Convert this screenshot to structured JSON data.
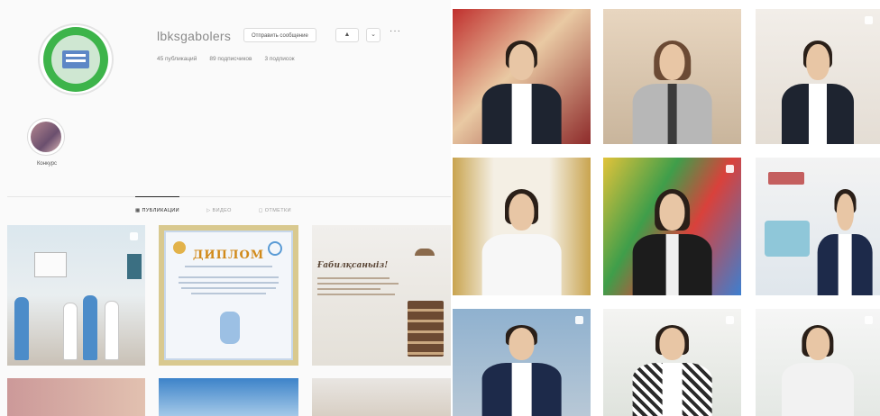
{
  "profile": {
    "username": "lbksgabolers",
    "message_button": "Отправить сообщение",
    "follow_icon": "▲",
    "dropdown_icon": "⌄",
    "more_icon": "···",
    "stats": {
      "posts": "45 публикаций",
      "followers": "89 подписчиков",
      "following": "3 подписок"
    }
  },
  "highlights": [
    {
      "label": "Конкурс"
    }
  ],
  "tabs": [
    {
      "label": "▦ ПУБЛИКАЦИИ",
      "active": true
    },
    {
      "label": "▷ ВИДЕО",
      "active": false
    },
    {
      "label": "◻ ОТМЕТКИ",
      "active": false
    }
  ],
  "posts": {
    "diploma_title": "ДИПЛОМ",
    "thanks_title": "Ғабилқсаныіз!"
  },
  "colors": {
    "avatar_green": "#3db44a",
    "vest_dark": "#1e2430",
    "suit_navy": "#1d2a4a",
    "blazer_grey": "#b7b7b7"
  }
}
